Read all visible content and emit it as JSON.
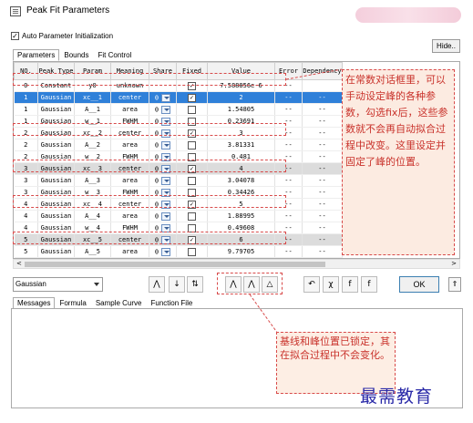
{
  "window": {
    "title": "Peak Fit Parameters"
  },
  "options": {
    "auto_init_label": "Auto Parameter Initialization",
    "auto_init_checked": true,
    "hide_label": "Hide.."
  },
  "tabs": [
    "Parameters",
    "Bounds",
    "Fit Control"
  ],
  "table": {
    "headers": [
      "NO.",
      "Peak Type",
      "Param",
      "Meaning",
      "Share",
      "Fixed",
      "Value",
      "Error",
      "Dependency"
    ],
    "rows": [
      {
        "no": "0",
        "type": "Constant",
        "param": "y0",
        "meaning": "unknown",
        "share": "",
        "fixed": true,
        "value": "7.588856e-6",
        "error": "--",
        "dep": "",
        "state": ""
      },
      {
        "no": "1",
        "type": "Gaussian",
        "param": "xc__1",
        "meaning": "center",
        "share": "0",
        "fixed": true,
        "value": "2",
        "error": "--",
        "dep": "--",
        "state": "selected"
      },
      {
        "no": "1",
        "type": "Gaussian",
        "param": "A__1",
        "meaning": "area",
        "share": "0",
        "fixed": false,
        "value": "1.54805",
        "error": "--",
        "dep": "--",
        "state": ""
      },
      {
        "no": "1",
        "type": "Gaussian",
        "param": "w__1",
        "meaning": "FWHM",
        "share": "0",
        "fixed": false,
        "value": "0.23691",
        "error": "--",
        "dep": "--",
        "state": ""
      },
      {
        "no": "2",
        "type": "Gaussian",
        "param": "xc__2",
        "meaning": "center",
        "share": "0",
        "fixed": true,
        "value": "3",
        "error": "--",
        "dep": "--",
        "state": ""
      },
      {
        "no": "2",
        "type": "Gaussian",
        "param": "A__2",
        "meaning": "area",
        "share": "0",
        "fixed": false,
        "value": "3.81331",
        "error": "--",
        "dep": "--",
        "state": ""
      },
      {
        "no": "2",
        "type": "Gaussian",
        "param": "w__2",
        "meaning": "FWHM",
        "share": "0",
        "fixed": false,
        "value": "0.481",
        "error": "--",
        "dep": "--",
        "state": ""
      },
      {
        "no": "3",
        "type": "Gaussian",
        "param": "xc__3",
        "meaning": "center",
        "share": "0",
        "fixed": true,
        "value": "4",
        "error": "--",
        "dep": "--",
        "state": "gray"
      },
      {
        "no": "3",
        "type": "Gaussian",
        "param": "A__3",
        "meaning": "area",
        "share": "0",
        "fixed": false,
        "value": "3.04078",
        "error": "--",
        "dep": "--",
        "state": ""
      },
      {
        "no": "3",
        "type": "Gaussian",
        "param": "w__3",
        "meaning": "FWHM",
        "share": "0",
        "fixed": false,
        "value": "0.34426",
        "error": "--",
        "dep": "--",
        "state": ""
      },
      {
        "no": "4",
        "type": "Gaussian",
        "param": "xc__4",
        "meaning": "center",
        "share": "0",
        "fixed": true,
        "value": "5",
        "error": "--",
        "dep": "--",
        "state": ""
      },
      {
        "no": "4",
        "type": "Gaussian",
        "param": "A__4",
        "meaning": "area",
        "share": "0",
        "fixed": false,
        "value": "1.88995",
        "error": "--",
        "dep": "--",
        "state": ""
      },
      {
        "no": "4",
        "type": "Gaussian",
        "param": "w__4",
        "meaning": "FWHM",
        "share": "0",
        "fixed": false,
        "value": "0.49608",
        "error": "--",
        "dep": "--",
        "state": ""
      },
      {
        "no": "5",
        "type": "Gaussian",
        "param": "xc__5",
        "meaning": "center",
        "share": "0",
        "fixed": true,
        "value": "6",
        "error": "--",
        "dep": "--",
        "state": "gray"
      },
      {
        "no": "5",
        "type": "Gaussian",
        "param": "A__5",
        "meaning": "area",
        "share": "0",
        "fixed": false,
        "value": "9.79705",
        "error": "--",
        "dep": "--",
        "state": ""
      }
    ]
  },
  "bottom": {
    "function_select": "Gaussian",
    "ok_label": "OK",
    "tabs": [
      "Messages",
      "Formula",
      "Sample Curve",
      "Function File"
    ]
  },
  "annotations": {
    "callout_right": "在常数对话框里，可以手动设定峰的各种参数，勾选fix后，这些参数就不会再自动拟合过程中改变。这里设定并固定了峰的位置。",
    "callout_bottom": "基线和峰位置已锁定，其在拟合过程中不会变化。",
    "watermark": "最需教育"
  },
  "colors": {
    "selected_row": "#2f80d9",
    "annotation_red": "#c9332c",
    "callout_bg": "#fcebe1"
  }
}
